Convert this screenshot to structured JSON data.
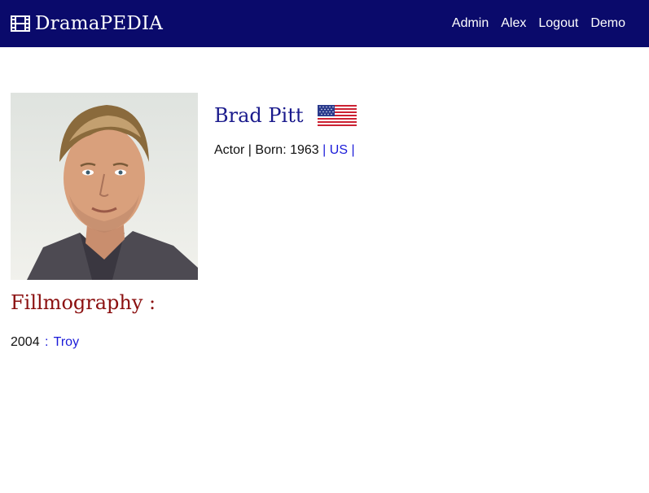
{
  "navbar": {
    "brand": "DramaPEDIA",
    "links": [
      "Admin",
      "Alex",
      "Logout",
      "Demo"
    ]
  },
  "actor": {
    "name": "Brad Pitt",
    "role": "Actor",
    "born_label": "Born:",
    "born_year": "1963",
    "country": "US",
    "photo_icon": "actor-portrait",
    "flag_icon": "us-flag-icon"
  },
  "filmography": {
    "title": "Fillmography :",
    "films": [
      {
        "year": "2004",
        "title": "Troy"
      }
    ]
  },
  "colors": {
    "navbar_bg": "#0a0a6b",
    "name": "#1a1a8c",
    "link": "#1a1ad9",
    "filmography_title": "#8b1010"
  }
}
